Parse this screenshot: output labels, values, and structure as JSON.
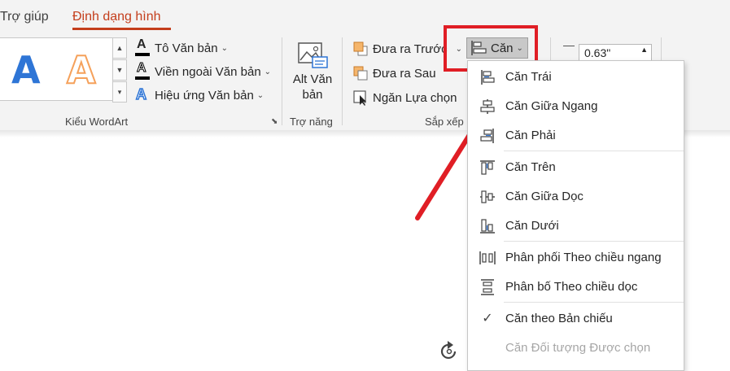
{
  "tabs": [
    {
      "label": "Trợ giúp"
    },
    {
      "label": "Định dạng hình"
    }
  ],
  "wordart": {
    "letters": [
      "A",
      "A"
    ],
    "text_fill": "Tô Văn bản",
    "text_outline": "Viền ngoài Văn bản",
    "text_effects": "Hiệu ứng Văn bản",
    "group_label": "Kiểu WordArt"
  },
  "accessibility": {
    "alt_line1": "Alt Văn",
    "alt_line2": "bản",
    "group_label": "Trợ năng"
  },
  "arrange": {
    "bring_forward": "Đưa ra Trước",
    "send_backward": "Đưa ra Sau",
    "selection_pane": "Ngăn Lựa chọn",
    "align": "Căn",
    "group_label": "Sắp xếp"
  },
  "size": {
    "height_value": "0.63\""
  },
  "align_menu": [
    {
      "label": "Căn Trái",
      "icon": "align-left-icon"
    },
    {
      "label": "Căn Giữa Ngang",
      "icon": "align-center-icon"
    },
    {
      "label": "Căn Phải",
      "icon": "align-right-icon"
    },
    {
      "label": "Căn Trên",
      "icon": "align-top-icon"
    },
    {
      "label": "Căn Giữa Dọc",
      "icon": "align-middle-icon"
    },
    {
      "label": "Căn Dưới",
      "icon": "align-bottom-icon"
    },
    {
      "label": "Phân phối Theo chiều ngang",
      "icon": "distribute-horizontal-icon"
    },
    {
      "label": "Phân bố Theo chiều dọc",
      "icon": "distribute-vertical-icon"
    },
    {
      "label": "Căn theo Bản chiếu",
      "icon": "checkmark-icon",
      "checked": true
    },
    {
      "label": "Căn Đối tượng Được chọn",
      "icon": "",
      "disabled": true
    }
  ],
  "colors": {
    "accent_tab": "#c43e1c",
    "highlight_red": "#e01e25",
    "wordart_blue": "#2e75d6",
    "wordart_orange": "#f5a15b"
  }
}
